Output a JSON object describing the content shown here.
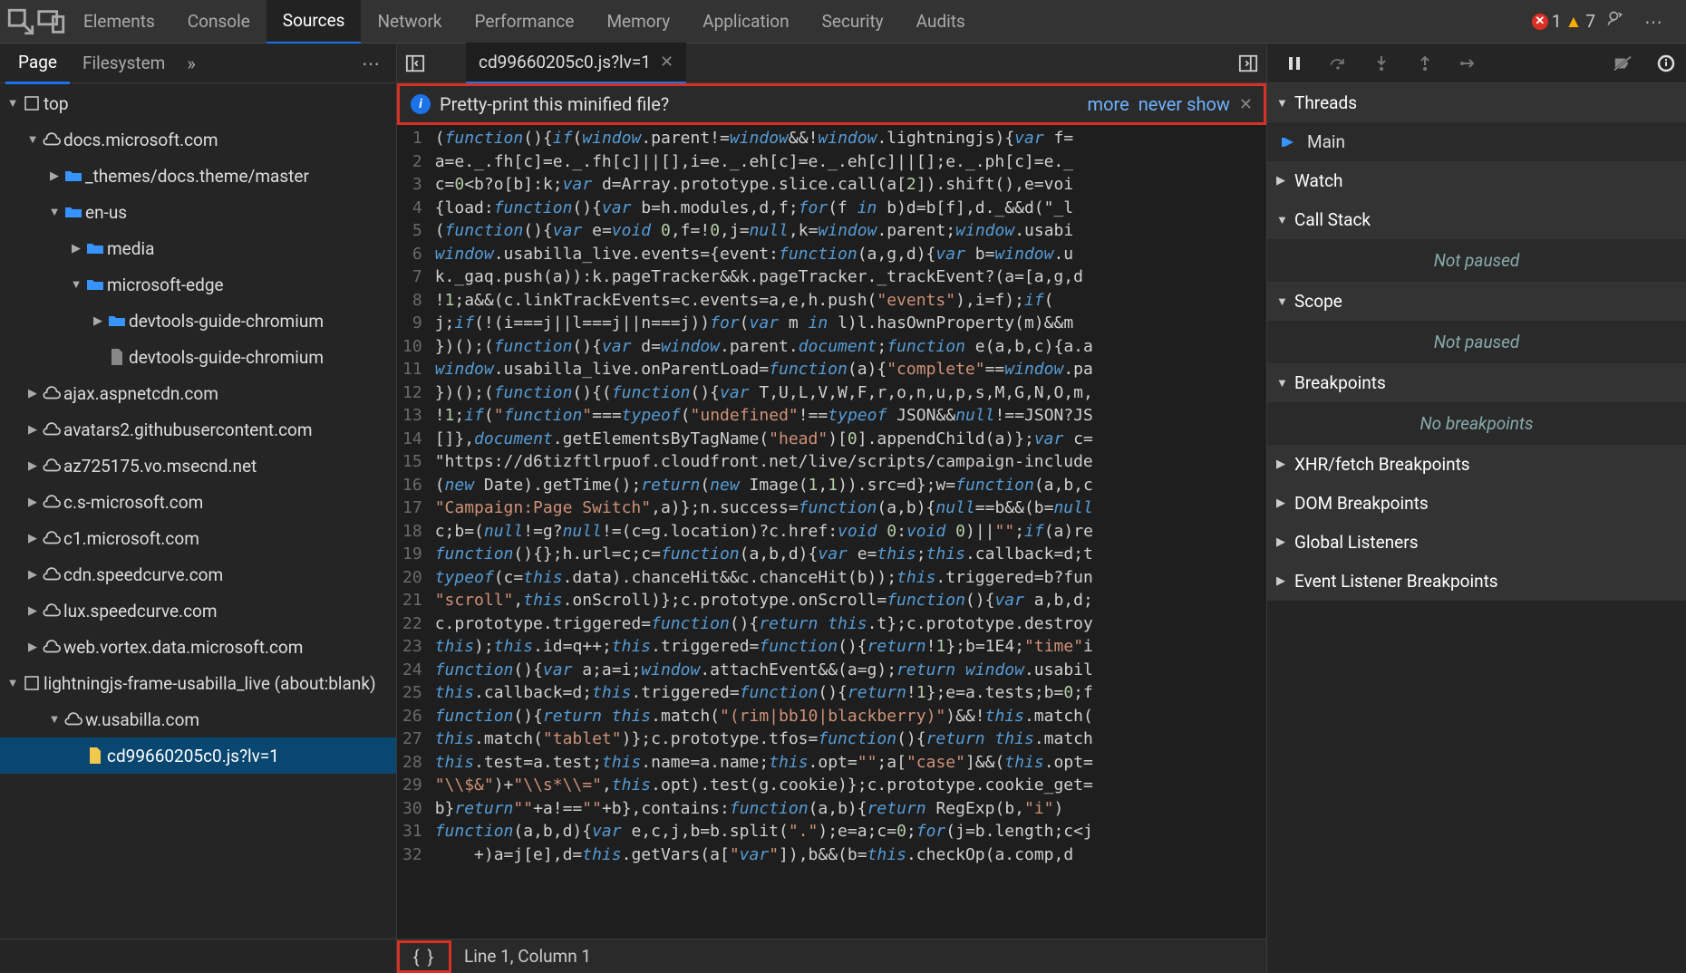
{
  "topTabs": {
    "items": [
      "Elements",
      "Console",
      "Sources",
      "Network",
      "Performance",
      "Memory",
      "Application",
      "Security",
      "Audits"
    ],
    "activeIndex": 2,
    "errorCount": "1",
    "warningCount": "7"
  },
  "leftTabs": {
    "page": "Page",
    "filesystem": "Filesystem"
  },
  "tree": {
    "top": "top",
    "docs": "docs.microsoft.com",
    "themes": "_themes/docs.theme/master",
    "enus": "en-us",
    "media": "media",
    "msedge": "microsoft-edge",
    "devfolder": "devtools-guide-chromium",
    "devfile": "devtools-guide-chromium",
    "ajax": "ajax.aspnetcdn.com",
    "avatars": "avatars2.githubusercontent.com",
    "az": "az725175.vo.msecnd.net",
    "csms": "c.s-microsoft.com",
    "c1ms": "c1.microsoft.com",
    "cdnspeed": "cdn.speedcurve.com",
    "luxspeed": "lux.speedcurve.com",
    "webvortex": "web.vortex.data.microsoft.com",
    "lightning": "lightningjs-frame-usabilla_live (about:blank)",
    "wusabilla": "w.usabilla.com",
    "jsfile": "cd99660205c0.js?lv=1"
  },
  "editor": {
    "activeFile": "cd99660205c0.js?lv=1",
    "infoBar": {
      "message": "Pretty-print this minified file?",
      "more": "more",
      "never": "never show"
    },
    "statusPos": "Line 1, Column 1",
    "formatSymbol": "{ }",
    "lines": [
      "(function(){if(window.parent!=window&&!window.lightningjs){var f=",
      "a=e._.fh[c]=e._.fh[c]||[],i=e._.eh[c]=e._.eh[c]||[];e._.ph[c]=e._",
      "c=0<b?o[b]:k;var d=Array.prototype.slice.call(a[2]).shift(),e=voi",
      "{load:function(){var b=h.modules,d,f;for(f in b)d=b[f],d._&&d(\"_l",
      "(function(){var e=void 0,f=!0,j=null,k=window.parent;window.usabi",
      "window.usabilla_live.events={event:function(a,g,d){var b=window.u",
      "k._gaq.push(a)):k.pageTracker&&k.pageTracker._trackEvent?(a=[a,g,d",
      "!1;a&&(c.linkTrackEvents=c.events=a,e,h.push(\"events\"),i=f);if(",
      "j;if(!(i===j||l===j||n===j))for(var m in l)l.hasOwnProperty(m)&&m",
      "})();(function(){var d=window.parent.document;function e(a,b,c){a.a",
      "window.usabilla_live.onParentLoad=function(a){\"complete\"==window.pa",
      "})();(function(){(function(){var T,U,L,V,W,F,r,o,n,u,p,s,M,G,N,O,m,",
      "!1;if(\"function\"===typeof(\"undefined\"!==typeof JSON&&null!==JSON?JS",
      "[]},document.getElementsByTagName(\"head\")[0].appendChild(a)};var c=",
      "\"https://d6tizftlrpuof.cloudfront.net/live/scripts/campaign-include",
      "(new Date).getTime();return(new Image(1,1)).src=d};w=function(a,b,c",
      "\"Campaign:Page Switch\",a)};n.success=function(a,b){null==b&&(b=null",
      "c;b=(null!=g?null!=(c=g.location)?c.href:void 0:void 0)||\"\";if(a)re",
      "function(){};h.url=c;c=function(a,b,d){var e=this;this.callback=d;t",
      "typeof(c=this.data).chanceHit&&c.chanceHit(b));this.triggered=b?fun",
      "\"scroll\",this.onScroll)};c.prototype.onScroll=function(){var a,b,d;",
      "c.prototype.triggered=function(){return this.t};c.prototype.destroy",
      "this);this.id=q++;this.triggered=function(){return!1};b=1E4;\"time\"i",
      "function(){var a;a=i;window.attachEvent&&(a=g);return window.usabil",
      "this.callback=d;this.triggered=function(){return!1};e=a.tests;b=0;f",
      "function(){return this.match(\"(rim|bb10|blackberry)\")&&!this.match(",
      "this.match(\"tablet\")};c.prototype.tfos=function(){return this.match",
      "this.test=a.test;this.name=a.name;this.opt=\"\";a[\"case\"]&&(this.opt=",
      "\"\\\\$&\")+\"\\\\s*\\\\=\",this.opt).test(g.cookie)};c.prototype.cookie_get=",
      "b}return\"\"+a!==\"\"+b},contains:function(a,b){return RegExp(b,\"i\")",
      "function(a,b,d){var e,c,j,b=b.split(\".\");e=a;c=0;for(j=b.length;c<j",
      "    +)a=j[e],d=this.getVars(a[\"var\"]),b&&(b=this.checkOp(a.comp,d"
    ]
  },
  "debug": {
    "threads": "Threads",
    "main": "Main",
    "watch": "Watch",
    "callstack": "Call Stack",
    "notpaused": "Not paused",
    "scope": "Scope",
    "breakpoints": "Breakpoints",
    "nobp": "No breakpoints",
    "xhr": "XHR/fetch Breakpoints",
    "dom": "DOM Breakpoints",
    "global": "Global Listeners",
    "evl": "Event Listener Breakpoints"
  }
}
